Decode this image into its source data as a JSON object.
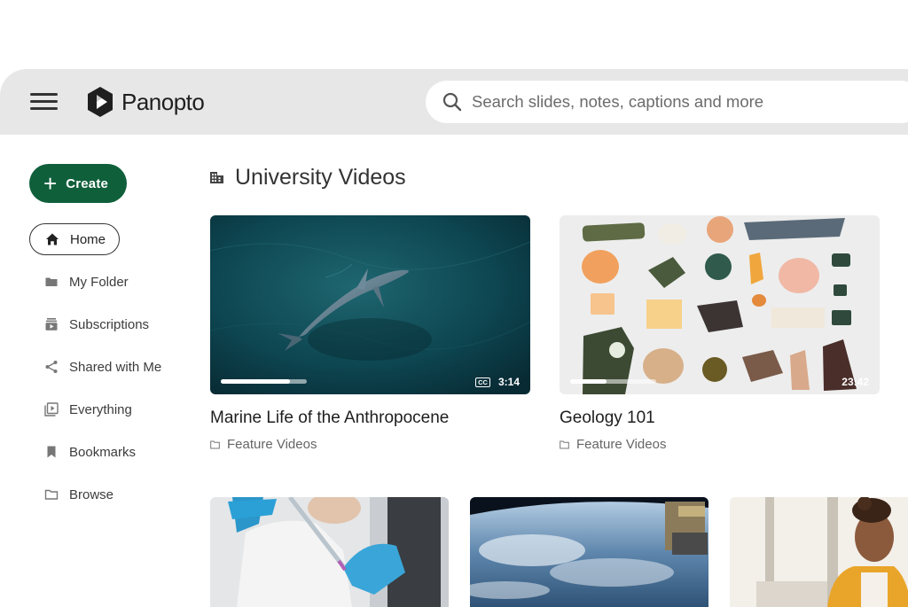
{
  "header": {
    "logo_text": "Panopto",
    "search_placeholder": "Search slides, notes, captions and more"
  },
  "sidebar": {
    "create_label": "Create",
    "items": [
      {
        "label": "Home",
        "icon": "home-icon",
        "active": true
      },
      {
        "label": "My Folder",
        "icon": "folder-icon"
      },
      {
        "label": "Subscriptions",
        "icon": "subscriptions-icon"
      },
      {
        "label": "Shared with Me",
        "icon": "share-icon"
      },
      {
        "label": "Everything",
        "icon": "playlist-icon"
      },
      {
        "label": "Bookmarks",
        "icon": "bookmark-icon"
      },
      {
        "label": "Browse",
        "icon": "folder-outline-icon"
      }
    ]
  },
  "main": {
    "section_title": "University Videos",
    "section_icon": "building-icon",
    "videos": [
      {
        "title": "Marine Life of the Anthropocene",
        "folder": "Feature Videos",
        "duration": "3:14",
        "captions": "CC",
        "progress": 0.8
      },
      {
        "title": "Geology 101",
        "folder": "Feature Videos",
        "duration": "23:42",
        "progress": 0.42
      },
      {
        "title": "",
        "folder": ""
      },
      {
        "title": "",
        "folder": ""
      },
      {
        "title": "",
        "folder": ""
      }
    ]
  },
  "colors": {
    "header_bg": "#e7e7e7",
    "create_button": "#0f5f3b"
  }
}
